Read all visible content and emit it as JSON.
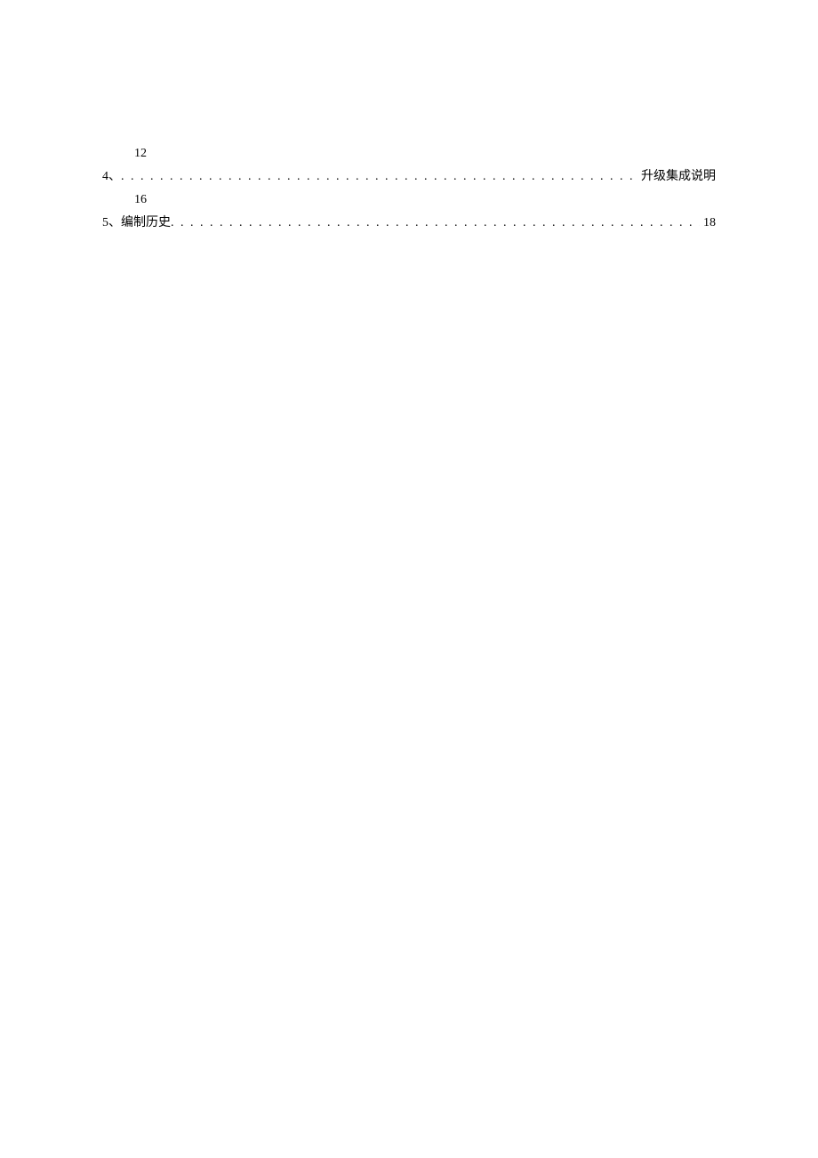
{
  "toc": {
    "line1_indent": "12",
    "entry4": {
      "prefix": "4、",
      "title": "",
      "suffix": "升级集成说明"
    },
    "line3_indent": "16",
    "entry5": {
      "prefix": "5、",
      "title": "编制历史",
      "suffix": "18"
    }
  }
}
